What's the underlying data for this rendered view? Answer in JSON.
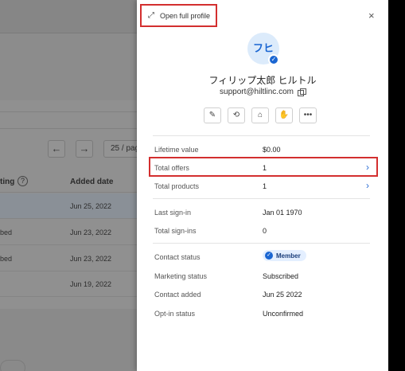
{
  "background": {
    "table_header": {
      "col1": "ting",
      "col2": "Added date"
    },
    "pager": "25 / page",
    "rows": [
      {
        "c1": "",
        "date": "Jun 25, 2022"
      },
      {
        "c1": "bed",
        "date": "Jun 23, 2022"
      },
      {
        "c1": "bed",
        "date": "Jun 23, 2022"
      },
      {
        "c1": "",
        "date": "Jun 19, 2022"
      }
    ]
  },
  "drawer": {
    "open_full_profile": "Open full profile",
    "avatar_initials": "フヒ",
    "name": "フィリップ太郎 ヒルトル",
    "email": "support@hiltlinc.com",
    "summary": [
      {
        "label": "Lifetime value",
        "value": "$0.00"
      },
      {
        "label": "Total offers",
        "value": "1"
      },
      {
        "label": "Total products",
        "value": "1"
      }
    ],
    "signin": [
      {
        "label": "Last sign-in",
        "value": "Jan 01 1970"
      },
      {
        "label": "Total sign-ins",
        "value": "0"
      }
    ],
    "contact": {
      "status_label": "Contact status",
      "status_badge": "Member",
      "marketing_label": "Marketing status",
      "marketing_value": "Subscribed",
      "added_label": "Contact added",
      "added_value": "Jun 25 2022",
      "optin_label": "Opt-in status",
      "optin_value": "Unconfirmed"
    }
  },
  "colors": {
    "accent": "#1a66d2",
    "highlight": "#d32f2f"
  }
}
